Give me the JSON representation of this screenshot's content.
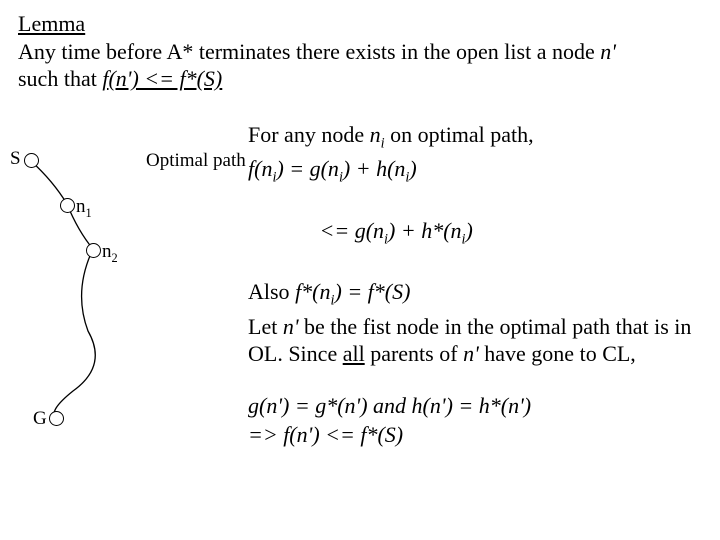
{
  "lemma": {
    "title": "Lemma",
    "line1_a": "Any time before A* terminates there exists in the open list a node ",
    "line1_b": "n'",
    "line2_a": "such that ",
    "line2_b": "f(n') <= f*(S)"
  },
  "diagram": {
    "optimal_path_label": "Optimal path",
    "S": "S",
    "n1": "n",
    "n1_sub": "1",
    "n2": "n",
    "n2_sub": "2",
    "G": "G"
  },
  "proof": {
    "p1_a": "For any node ",
    "p1_b": "n",
    "p1_c": " on optimal path,",
    "p2_a": "f(n",
    "p2_b": ") = g(n",
    "p2_c": ") + h(n",
    "p2_d": ")",
    "p3_a": "     <= g(n",
    "p3_b": ") + h*(n",
    "p3_c": ")",
    "p4_a": "Also ",
    "p4_b": "f*(n",
    "p4_c": ") = f*(S)",
    "p5_a": "Let ",
    "p5_b": "n'",
    "p5_c": " be the fist node in the optimal path that is in OL. Since ",
    "p5_d": "all",
    "p5_e": " parents of ",
    "p5_f": "n'",
    "p5_g": " have gone to CL,",
    "p6_a": "g(n') = g*(n') and h(n') = h*(n')",
    "p7_a": "=> f(n') <= f*(S)",
    "i": "i"
  }
}
